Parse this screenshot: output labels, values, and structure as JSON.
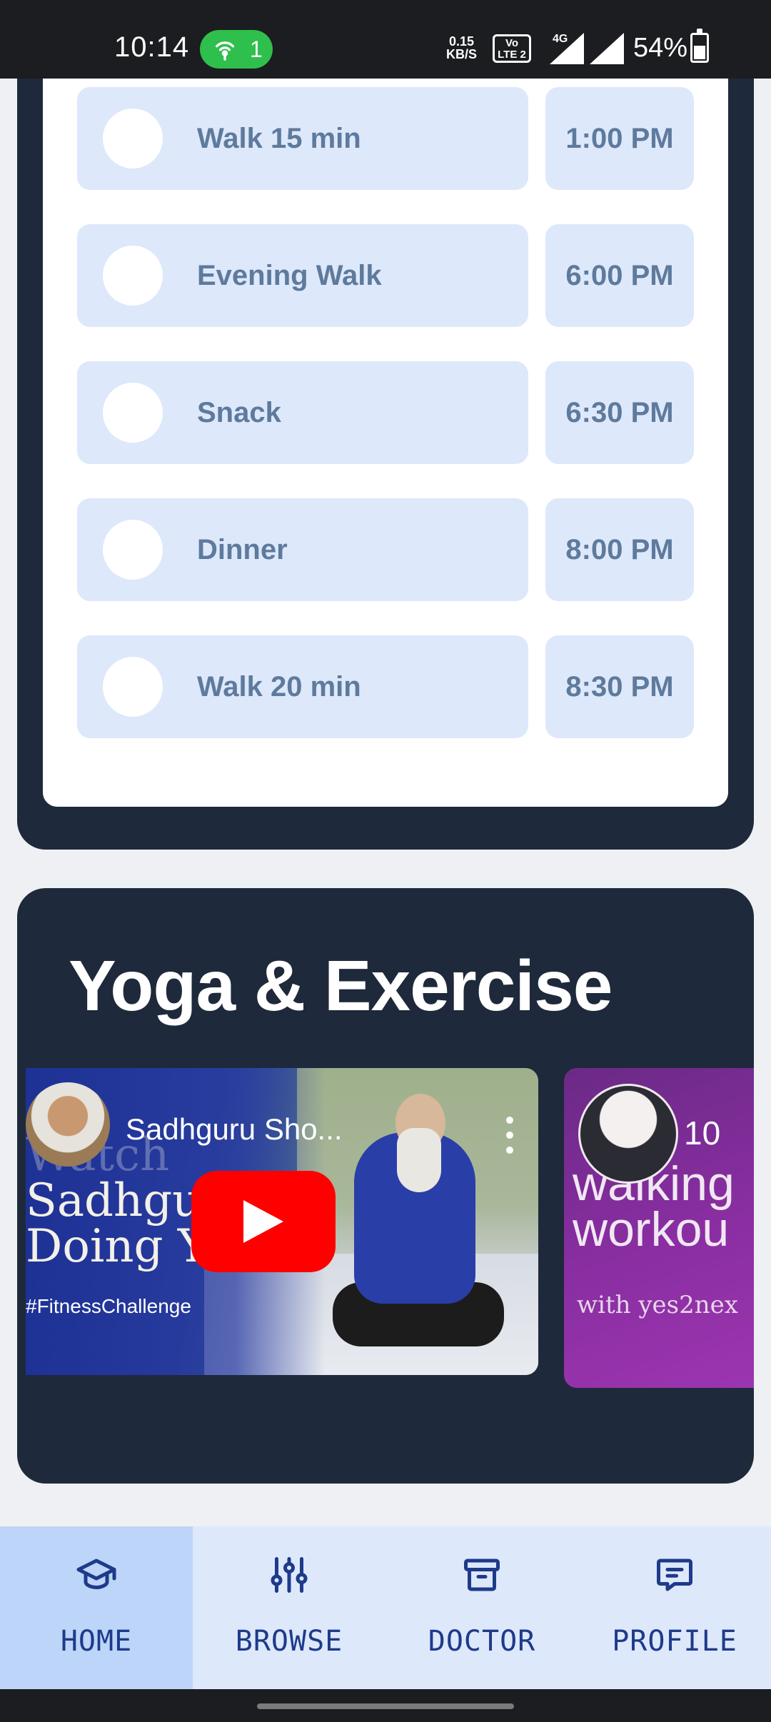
{
  "status_bar": {
    "time": "10:14",
    "hotspot_count": "1",
    "net_speed_value": "0.15",
    "net_speed_unit": "KB/S",
    "volte_top": "Vo",
    "volte_bottom": "LTE 2",
    "network_type": "4G",
    "battery": "54%"
  },
  "schedule": {
    "items": [
      {
        "label": "Walk 15 min",
        "time": "1:00 PM"
      },
      {
        "label": "Evening Walk",
        "time": "6:00 PM"
      },
      {
        "label": "Snack",
        "time": "6:30 PM"
      },
      {
        "label": "Dinner",
        "time": "8:00 PM"
      },
      {
        "label": "Walk 20 min",
        "time": "8:30 PM"
      }
    ]
  },
  "yoga": {
    "title": "Yoga & Exercise",
    "videos": [
      {
        "title": "Sadhguru Sho...",
        "overlay_lines": [
          "Watch",
          "Sadhguru",
          "Doing Yoga"
        ],
        "hashtag": "#FitnessChallenge"
      },
      {
        "title": "10",
        "overlay_lines": [
          "walking",
          "workou"
        ],
        "subtitle": "with yes2nex"
      }
    ]
  },
  "bottom_nav": {
    "items": [
      {
        "label": "HOME",
        "icon": "graduation-cap-icon",
        "active": true
      },
      {
        "label": "BROWSE",
        "icon": "sliders-icon",
        "active": false
      },
      {
        "label": "DOCTOR",
        "icon": "archive-box-icon",
        "active": false
      },
      {
        "label": "PROFILE",
        "icon": "chat-message-icon",
        "active": false
      }
    ]
  },
  "colors": {
    "card_dark": "#1e293b",
    "task_bg": "#dde8fb",
    "task_text": "#5e7a9c",
    "nav_active": "#bcd5f8",
    "nav_text": "#1e3a8a"
  }
}
